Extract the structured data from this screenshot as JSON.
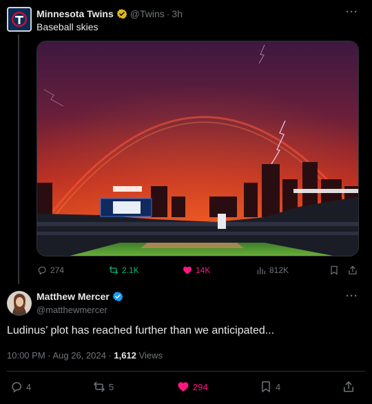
{
  "parent": {
    "author_name": "Minnesota Twins",
    "handle": "@Twins",
    "separator": "·",
    "time": "3h",
    "text": "Baseball skies",
    "more_label": "···",
    "avatar_icon": "twins-logo-icon",
    "stats": {
      "replies": "274",
      "retweets": "2.1K",
      "likes": "14K",
      "views": "812K"
    }
  },
  "tweet": {
    "author_name": "Matthew Mercer",
    "handle": "@matthewmercer",
    "more_label": "···",
    "text": "Ludinus’ plot has reached further than we anticipated...",
    "timestamp": "10:00 PM · Aug 26, 2024 · ",
    "views_count": "1,612",
    "views_label": " Views",
    "stats": {
      "replies": "4",
      "retweets": "5",
      "likes": "294",
      "bookmarks": "4"
    }
  },
  "colors": {
    "background": "#000000",
    "text_primary": "#e7e9ea",
    "text_secondary": "#71767b",
    "retweet_green": "#00ba7c",
    "like_pink": "#f91880",
    "verified_blue": "#1d9bf0",
    "verified_gold": "#e2b719"
  }
}
